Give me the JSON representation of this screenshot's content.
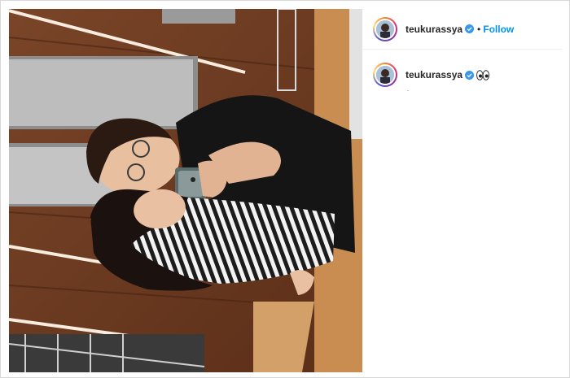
{
  "post": {
    "username": "teukurassya",
    "separator": "•",
    "follow_label": "Follow",
    "caption_emoji": "👀"
  },
  "icons": {
    "verified": "verified-badge-icon",
    "emoji": "eyes-emoji-icon"
  },
  "colors": {
    "accent": "#0095f6",
    "verified": "#3897f0",
    "text": "#262626"
  }
}
